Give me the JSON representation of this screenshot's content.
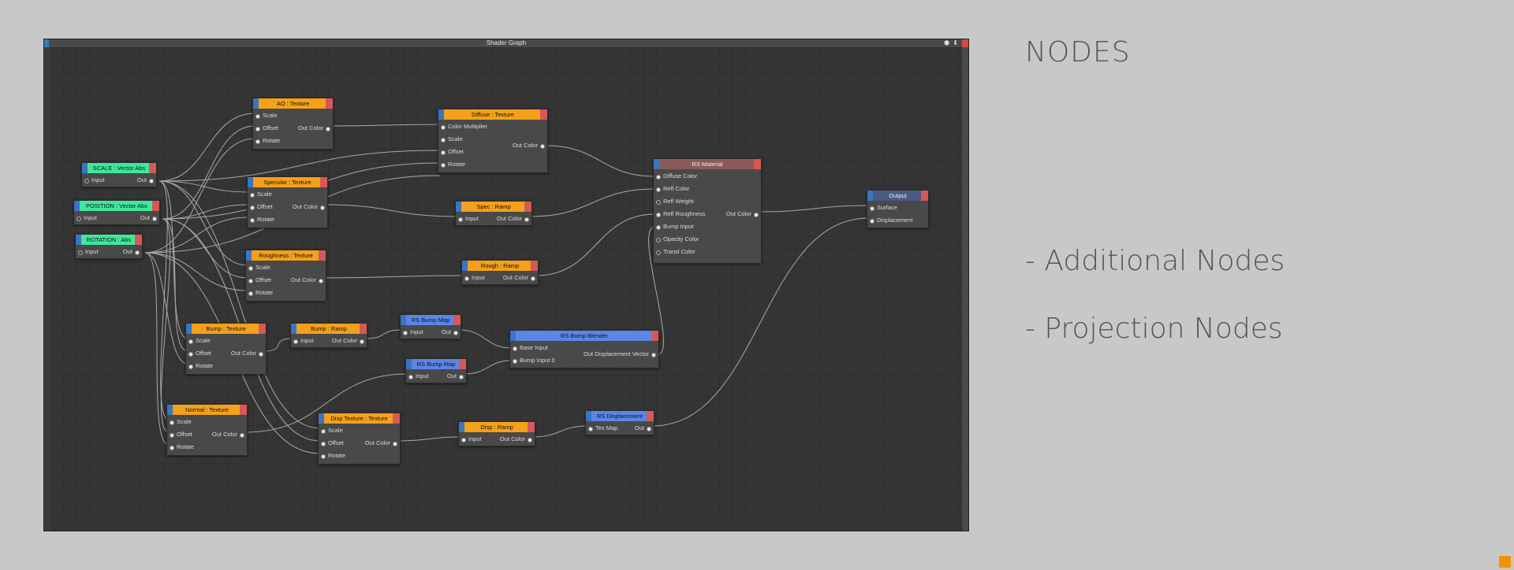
{
  "window": {
    "title": "Shader Graph",
    "buttons": "⬢ ⬇"
  },
  "slide": {
    "heading": "NODES",
    "bullets": [
      "- Additional Nodes",
      "- Projection Nodes"
    ]
  },
  "colors": {
    "texture": "#f5a01a",
    "vector": "#3fe89a",
    "redshift": "#5a86e8",
    "material": "#8b5a5a",
    "output": "#4a5b86",
    "accent": "#f39200"
  },
  "nodes": {
    "ao": {
      "title": "AO : Texture",
      "inputs": [
        "Scale",
        "Offset",
        "Rotate"
      ],
      "output": "Out Color"
    },
    "diffuse": {
      "title": "Diffuse : Texture",
      "inputs": [
        "Color Multiplier",
        "Scale",
        "Offset",
        "Rotate"
      ],
      "output": "Out Color"
    },
    "scale": {
      "title": "SCALE : Vector Abs",
      "inputs": [
        "Input"
      ],
      "output": "Out"
    },
    "position": {
      "title": "POSITION : Vector Abs",
      "inputs": [
        "Input"
      ],
      "output": "Out"
    },
    "rotation": {
      "title": "ROTATION : Abs",
      "inputs": [
        "Input"
      ],
      "output": "Out"
    },
    "specular": {
      "title": "Specular : Texture",
      "inputs": [
        "Scale",
        "Offset",
        "Rotate"
      ],
      "output": "Out Color"
    },
    "specramp": {
      "title": "Spec : Ramp",
      "inputs": [
        "Input"
      ],
      "output": "Out Color"
    },
    "roughness": {
      "title": "Roughness : Texture",
      "inputs": [
        "Scale",
        "Offset",
        "Rotate"
      ],
      "output": "Out Color"
    },
    "roughramp": {
      "title": "Rough : Ramp",
      "inputs": [
        "Input"
      ],
      "output": "Out Color"
    },
    "material": {
      "title": "RS Material",
      "inputs": [
        "Diffuse Color",
        "Refl Color",
        "Refl Weight",
        "Refl Roughness",
        "Bump Input",
        "Opacity Color",
        "Transl Color"
      ],
      "output": "Out Color"
    },
    "output": {
      "title": "Output",
      "inputs": [
        "Surface",
        "Displacement"
      ]
    },
    "bump": {
      "title": "Bump : Texture",
      "inputs": [
        "Scale",
        "Offset",
        "Rotate"
      ],
      "output": "Out Color"
    },
    "bumpramp": {
      "title": "Bump : Ramp",
      "inputs": [
        "Input"
      ],
      "output": "Out Color"
    },
    "bumpmap1": {
      "title": "RS Bump Map",
      "inputs": [
        "Input"
      ],
      "output": "Out"
    },
    "bumpmap2": {
      "title": "RS Bump Map",
      "inputs": [
        "Input"
      ],
      "output": "Out"
    },
    "blender": {
      "title": "RS Bump Blender",
      "inputs": [
        "Base Input",
        "Bump Input 0"
      ],
      "output": "Out Displacement Vector"
    },
    "normal": {
      "title": "Normal : Texture",
      "inputs": [
        "Scale",
        "Offset",
        "Rotate"
      ],
      "output": "Out Color"
    },
    "disptex": {
      "title": "Disp Texture : Texture",
      "inputs": [
        "Scale",
        "Offset",
        "Rotate"
      ],
      "output": "Out Color"
    },
    "dispramp": {
      "title": "Disp : Ramp",
      "inputs": [
        "Input"
      ],
      "output": "Out Color"
    },
    "displacement": {
      "title": "RS Displacement",
      "inputs": [
        "Tex Map"
      ],
      "output": "Out"
    }
  }
}
